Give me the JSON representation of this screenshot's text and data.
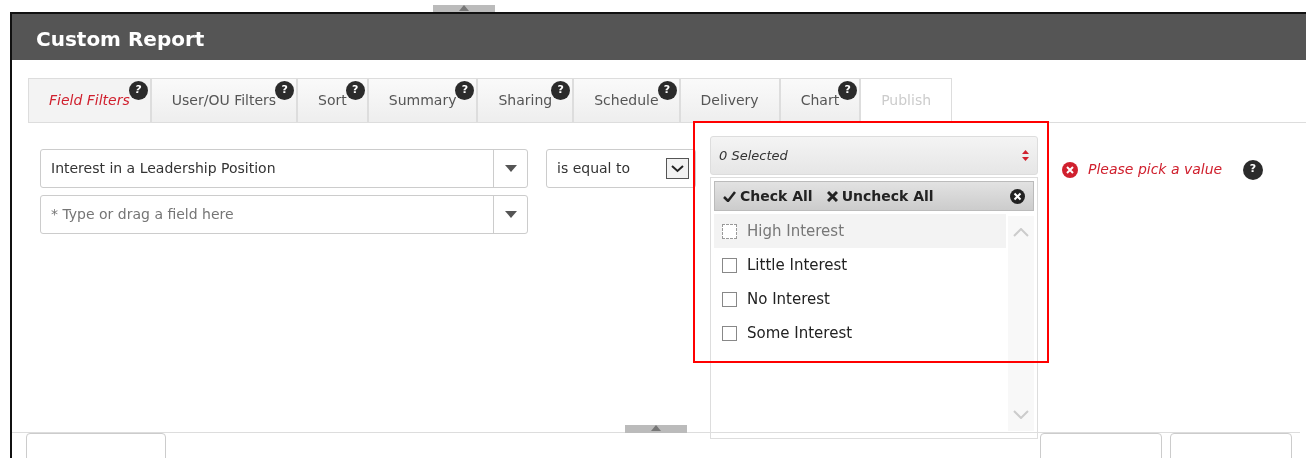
{
  "window": {
    "title": "Custom Report"
  },
  "tabs": [
    {
      "label": "Field Filters",
      "selected": true,
      "help": "?",
      "disabled": false
    },
    {
      "label": "User/OU Filters",
      "selected": false,
      "help": "?",
      "disabled": false
    },
    {
      "label": "Sort",
      "selected": false,
      "help": "?",
      "disabled": false
    },
    {
      "label": "Summary",
      "selected": false,
      "help": "?",
      "disabled": false
    },
    {
      "label": "Sharing",
      "selected": false,
      "help": "?",
      "disabled": false
    },
    {
      "label": "Schedule",
      "selected": false,
      "help": "?",
      "disabled": false
    },
    {
      "label": "Delivery",
      "selected": false,
      "disabled": false
    },
    {
      "label": "Chart",
      "selected": false,
      "help": "?",
      "disabled": false
    },
    {
      "label": "Publish",
      "selected": false,
      "disabled": true
    }
  ],
  "filter": {
    "field": "Interest in a Leadership Position",
    "new_field_placeholder": "* Type or drag a field here",
    "operator": "is equal to",
    "value": {
      "summary": "0 Selected",
      "check_all": "Check All",
      "uncheck_all": "Uncheck All",
      "options": [
        {
          "label": "High Interest",
          "checked": false,
          "focused": true
        },
        {
          "label": "Little Interest",
          "checked": false,
          "focused": false
        },
        {
          "label": "No Interest",
          "checked": false,
          "focused": false
        },
        {
          "label": "Some Interest",
          "checked": false,
          "focused": false
        }
      ]
    },
    "error": "Please pick a value",
    "help": "?"
  }
}
